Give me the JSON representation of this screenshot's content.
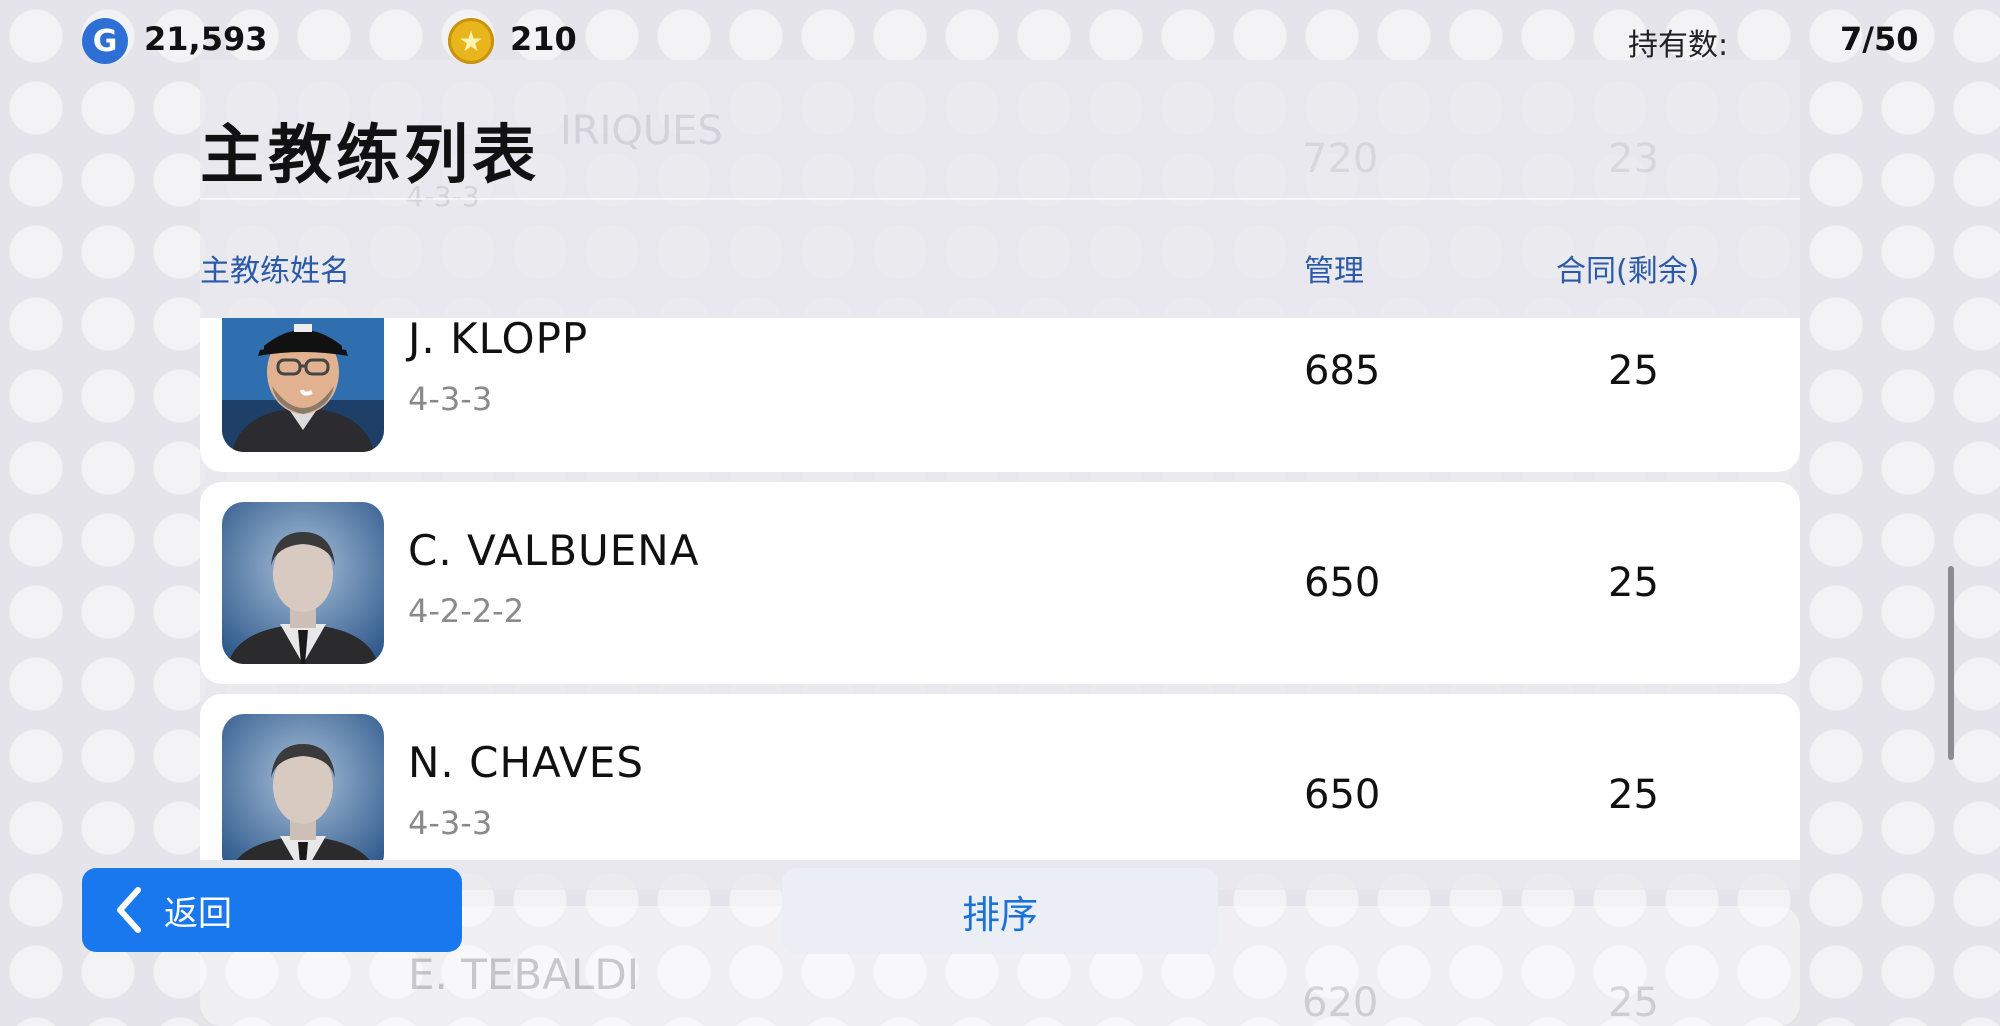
{
  "top_bar": {
    "gp_icon": "G",
    "gp_amount": "21,593",
    "coin_icon": "★",
    "coin_amount": "210",
    "holding_label": "持有数:",
    "holding_value": "7/50"
  },
  "header": {
    "title": "主教练列表",
    "columns": {
      "name": "主教练姓名",
      "management": "管理",
      "contract": "合同(剩余)"
    }
  },
  "ghost_row": {
    "name": "IRIQUES",
    "formation": "4-3-3",
    "management": "720",
    "contract": "23"
  },
  "coaches": [
    {
      "name": "J. KLOPP",
      "formation": "4-3-3",
      "management": "685",
      "contract": "25",
      "avatar": "photo"
    },
    {
      "name": "C. VALBUENA",
      "formation": "4-2-2-2",
      "management": "650",
      "contract": "25",
      "avatar": "silhouette"
    },
    {
      "name": "N. CHAVES",
      "formation": "4-3-3",
      "management": "650",
      "contract": "25",
      "avatar": "silhouette"
    }
  ],
  "faded_row": {
    "name": "E. TEBALDI",
    "management": "620",
    "contract": "25"
  },
  "buttons": {
    "back": "返回",
    "sort": "排序"
  },
  "colors": {
    "accent_blue": "#1a78ee",
    "column_header_blue": "#2a5aa8"
  }
}
